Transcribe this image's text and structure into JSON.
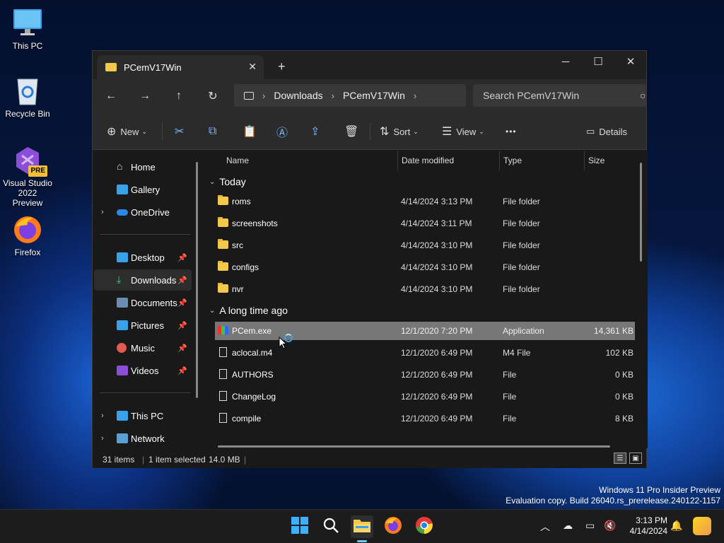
{
  "desktop": {
    "icons": [
      {
        "label": "This PC",
        "icon": "monitor-icon"
      },
      {
        "label": "Recycle Bin",
        "icon": "recycle-bin-icon"
      },
      {
        "label": "Visual Studio 2022 Preview",
        "badge": "PRE",
        "icon": "visual-studio-icon"
      },
      {
        "label": "Firefox",
        "icon": "firefox-icon"
      }
    ],
    "watermark": {
      "line1": "Windows 11 Pro Insider Preview",
      "line2": "Evaluation copy. Build 26040.rs_prerelease.240122-1157"
    }
  },
  "window": {
    "tab_title": "PCemV17Win",
    "breadcrumb": [
      "Downloads",
      "PCemV17Win"
    ],
    "search_placeholder": "Search PCemV17Win",
    "toolbar": {
      "new_label": "New",
      "sort_label": "Sort",
      "view_label": "View",
      "more_label": "•••",
      "details_label": "Details"
    },
    "nav": {
      "items": [
        {
          "label": "Home"
        },
        {
          "label": "Gallery"
        },
        {
          "label": "OneDrive"
        },
        {
          "label": "Desktop"
        },
        {
          "label": "Downloads"
        },
        {
          "label": "Documents"
        },
        {
          "label": "Pictures"
        },
        {
          "label": "Music"
        },
        {
          "label": "Videos"
        },
        {
          "label": "This PC"
        },
        {
          "label": "Network"
        }
      ]
    },
    "columns": {
      "name": "Name",
      "date": "Date modified",
      "type": "Type",
      "size": "Size"
    },
    "groups": {
      "today": "Today",
      "older": "A long time ago"
    },
    "files": [
      {
        "name": "roms",
        "date": "4/14/2024 3:13 PM",
        "type": "File folder",
        "size": ""
      },
      {
        "name": "screenshots",
        "date": "4/14/2024 3:11 PM",
        "type": "File folder",
        "size": ""
      },
      {
        "name": "src",
        "date": "4/14/2024 3:10 PM",
        "type": "File folder",
        "size": ""
      },
      {
        "name": "configs",
        "date": "4/14/2024 3:10 PM",
        "type": "File folder",
        "size": ""
      },
      {
        "name": "nvr",
        "date": "4/14/2024 3:10 PM",
        "type": "File folder",
        "size": ""
      },
      {
        "name": "PCem.exe",
        "date": "12/1/2020 7:20 PM",
        "type": "Application",
        "size": "14,361 KB"
      },
      {
        "name": "aclocal.m4",
        "date": "12/1/2020 6:49 PM",
        "type": "M4 File",
        "size": "102 KB"
      },
      {
        "name": "AUTHORS",
        "date": "12/1/2020 6:49 PM",
        "type": "File",
        "size": "0 KB"
      },
      {
        "name": "ChangeLog",
        "date": "12/1/2020 6:49 PM",
        "type": "File",
        "size": "0 KB"
      },
      {
        "name": "compile",
        "date": "12/1/2020 6:49 PM",
        "type": "File",
        "size": "8 KB"
      }
    ],
    "status": {
      "count": "31 items",
      "selected": "1 item selected",
      "size": "14.0 MB"
    }
  },
  "taskbar": {
    "clock_time": "3:13 PM",
    "clock_date": "4/14/2024"
  },
  "colors": {
    "selection": "#777777",
    "folder": "#f2c94c",
    "accent": "#1e6bd8"
  }
}
